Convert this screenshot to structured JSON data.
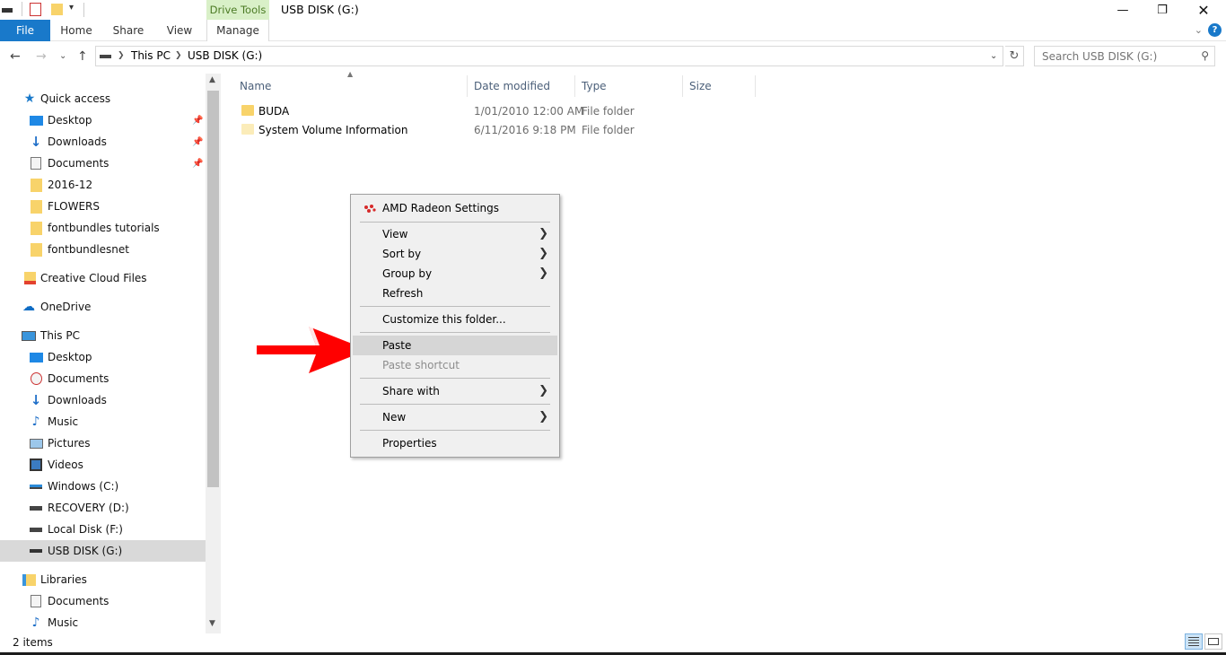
{
  "window": {
    "context_tab": "Drive Tools",
    "title": "USB DISK (G:)",
    "minimize_icon": "minimize-icon",
    "restore_icon": "restore-icon",
    "close_icon": "close-icon"
  },
  "ribbon": {
    "tabs": [
      "File",
      "Home",
      "Share",
      "View",
      "Manage"
    ]
  },
  "address": {
    "crumbs": [
      "This PC",
      "USB DISK (G:)"
    ],
    "search_placeholder": "Search USB DISK (G:)"
  },
  "sidebar": {
    "items": [
      {
        "label": "Quick access",
        "icon": "star-icon"
      },
      {
        "label": "Desktop",
        "icon": "desktop-icon",
        "pinned": true
      },
      {
        "label": "Downloads",
        "icon": "download-icon",
        "pinned": true
      },
      {
        "label": "Documents",
        "icon": "documents-icon",
        "pinned": true
      },
      {
        "label": "2016-12",
        "icon": "folder-icon"
      },
      {
        "label": "FLOWERS",
        "icon": "folder-icon"
      },
      {
        "label": "fontbundles tutorials",
        "icon": "folder-icon"
      },
      {
        "label": "fontbundlesnet",
        "icon": "folder-icon"
      },
      {
        "label": "Creative Cloud Files",
        "icon": "creative-cloud-icon"
      },
      {
        "label": "OneDrive",
        "icon": "cloud-icon"
      },
      {
        "label": "This PC",
        "icon": "computer-icon"
      },
      {
        "label": "Desktop",
        "icon": "desktop-icon"
      },
      {
        "label": "Documents",
        "icon": "documents-icon"
      },
      {
        "label": "Downloads",
        "icon": "download-icon"
      },
      {
        "label": "Music",
        "icon": "music-icon"
      },
      {
        "label": "Pictures",
        "icon": "pictures-icon"
      },
      {
        "label": "Videos",
        "icon": "videos-icon"
      },
      {
        "label": "Windows (C:)",
        "icon": "drive-icon"
      },
      {
        "label": "RECOVERY (D:)",
        "icon": "drive-icon"
      },
      {
        "label": "Local Disk (F:)",
        "icon": "drive-icon"
      },
      {
        "label": "USB DISK (G:)",
        "icon": "usb-drive-icon",
        "selected": true
      },
      {
        "label": "Libraries",
        "icon": "libraries-icon"
      },
      {
        "label": "Documents",
        "icon": "documents-icon"
      },
      {
        "label": "Music",
        "icon": "music-icon"
      }
    ]
  },
  "files": {
    "columns": [
      "Name",
      "Date modified",
      "Type",
      "Size"
    ],
    "rows": [
      {
        "name": "BUDA",
        "date": "1/01/2010 12:00 AM",
        "type": "File folder",
        "size": ""
      },
      {
        "name": "System Volume Information",
        "date": "6/11/2016 9:18 PM",
        "type": "File folder",
        "size": ""
      }
    ]
  },
  "context_menu": {
    "items": [
      {
        "label": "AMD Radeon Settings"
      },
      {
        "label": "View",
        "submenu": true
      },
      {
        "label": "Sort by",
        "submenu": true
      },
      {
        "label": "Group by",
        "submenu": true
      },
      {
        "label": "Refresh"
      },
      {
        "label": "Customize this folder..."
      },
      {
        "label": "Paste",
        "highlighted": true
      },
      {
        "label": "Paste shortcut",
        "disabled": true
      },
      {
        "label": "Share with",
        "submenu": true
      },
      {
        "label": "New",
        "submenu": true
      },
      {
        "label": "Properties"
      }
    ]
  },
  "status": {
    "item_count": "2 items"
  },
  "colors": {
    "file_tab": "#1979ca",
    "drive_tools_bg": "#d9f0c8",
    "selected_nav": "#d9d9d9",
    "menu_bg": "#f0f0f0",
    "arrow": "#ff0000"
  }
}
